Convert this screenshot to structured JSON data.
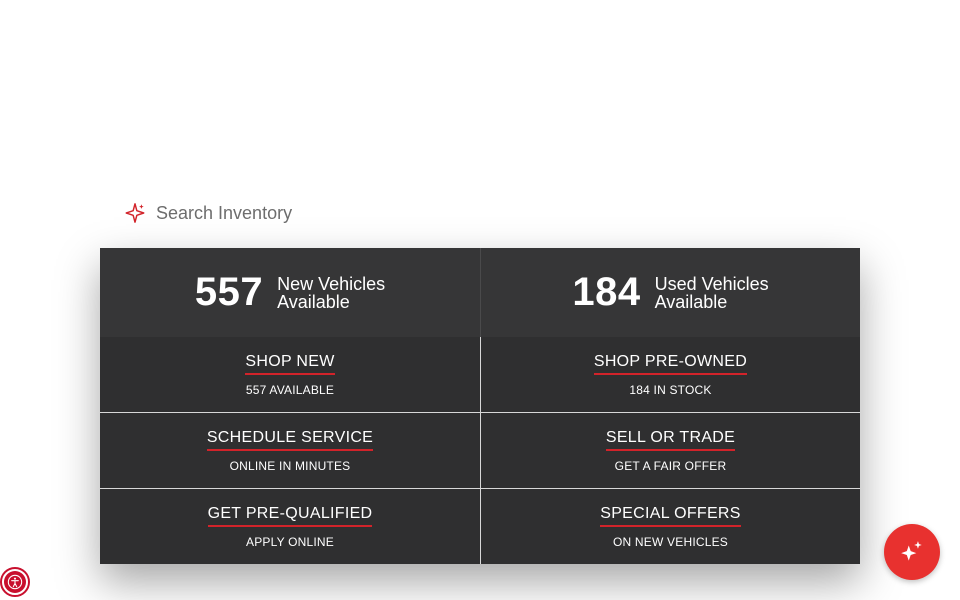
{
  "search": {
    "placeholder": "Search Inventory",
    "icon": "sparkle-icon"
  },
  "stats": [
    {
      "count": "557",
      "label_line1": "New Vehicles",
      "label_line2": "Available"
    },
    {
      "count": "184",
      "label_line1": "Used Vehicles",
      "label_line2": "Available"
    }
  ],
  "links": [
    {
      "title": "SHOP NEW",
      "subtitle": "557 AVAILABLE"
    },
    {
      "title": "SHOP PRE-OWNED",
      "subtitle": "184 IN STOCK"
    },
    {
      "title": "SCHEDULE SERVICE",
      "subtitle": "ONLINE IN MINUTES"
    },
    {
      "title": "SELL OR TRADE",
      "subtitle": "GET A FAIR OFFER"
    },
    {
      "title": "GET PRE-QUALIFIED",
      "subtitle": "APPLY ONLINE"
    },
    {
      "title": "SPECIAL OFFERS",
      "subtitle": "ON NEW VEHICLES"
    }
  ],
  "colors": {
    "accent": "#d2232a",
    "panel": "#2f2f30",
    "stat_bar": "#363637",
    "fab": "#e8312f"
  },
  "icons": {
    "fab": "sparkles-icon",
    "accessibility": "accessibility-icon"
  }
}
